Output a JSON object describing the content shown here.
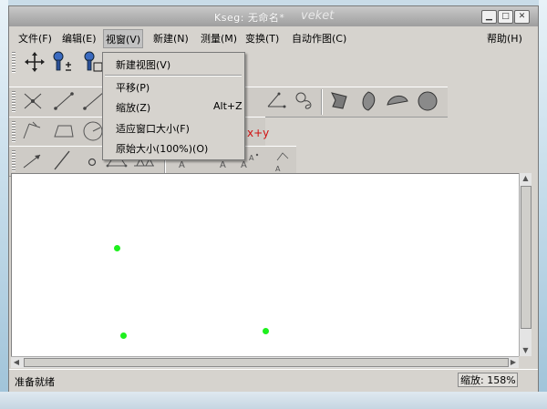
{
  "window": {
    "title": "Kseg: 无命名*",
    "watermark": "veket",
    "minimize": "▁",
    "maximize": "□",
    "close": "✕"
  },
  "menubar": {
    "items": [
      {
        "label": "文件(F)"
      },
      {
        "label": "编辑(E)"
      },
      {
        "label": "视窗(V)"
      },
      {
        "label": "新建(N)"
      },
      {
        "label": "测量(M)"
      },
      {
        "label": "变换(T)"
      },
      {
        "label": "自动作图(C)"
      }
    ],
    "help": "帮助(H)"
  },
  "view_menu": {
    "items": [
      {
        "label": "新建视图(V)",
        "accel": ""
      },
      {
        "label": "平移(P)",
        "accel": ""
      },
      {
        "label": "缩放(Z)",
        "accel": "Alt+Z"
      },
      {
        "label": "适应窗口大小(F)",
        "accel": ""
      },
      {
        "label": "原始大小(100%)(O)",
        "accel": ""
      }
    ]
  },
  "toolbar": {
    "partial_text": "x+y"
  },
  "status": {
    "text": "准备就绪",
    "zoom": "缩放: 158%"
  },
  "colors": {
    "point": "#1ef01e",
    "window_bg": "#d6d3ce"
  },
  "icons": [
    "move-icon",
    "zoom-in-icon",
    "zoom-fit-icon",
    "point-icon",
    "segment-icon",
    "ray-icon",
    "circle-icon",
    "arc-icon",
    "polygon-icon",
    "fill-icon",
    "text-label-icon"
  ]
}
